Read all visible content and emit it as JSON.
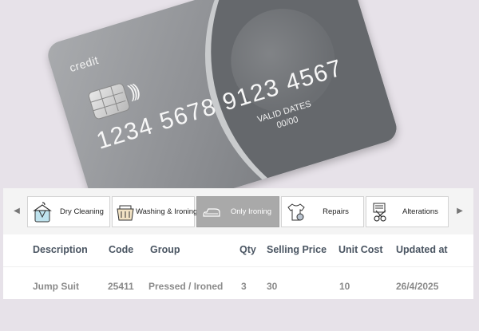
{
  "card": {
    "brand": "credit",
    "number": "1234 5678 9123 4567",
    "valid_label": "VALID DATES",
    "valid_value": "00/00"
  },
  "categories": [
    {
      "label": "Dry Cleaning",
      "icon": "dry-cleaning-icon",
      "active": false
    },
    {
      "label": "Washing & Ironing",
      "icon": "washing-basket-icon",
      "active": false
    },
    {
      "label": "Only Ironing",
      "icon": "iron-icon",
      "active": true
    },
    {
      "label": "Repairs",
      "icon": "shirt-gear-icon",
      "active": false
    },
    {
      "label": "Alterations",
      "icon": "scissors-icon",
      "active": false
    }
  ],
  "nav": {
    "prev": "◀",
    "next": "▶"
  },
  "table": {
    "headers": [
      "Description",
      "Code",
      "Group",
      "Qty",
      "Selling Price",
      "Unit Cost",
      "Updated at"
    ],
    "rows": [
      [
        "Jump Suit",
        "25411",
        "Pressed / Ironed",
        "3",
        "30",
        "10",
        "26/4/2025"
      ]
    ]
  },
  "colors": {
    "active_tab": "#a9a9a9",
    "background": "#e7e2e9",
    "header_text": "#4a5562"
  }
}
